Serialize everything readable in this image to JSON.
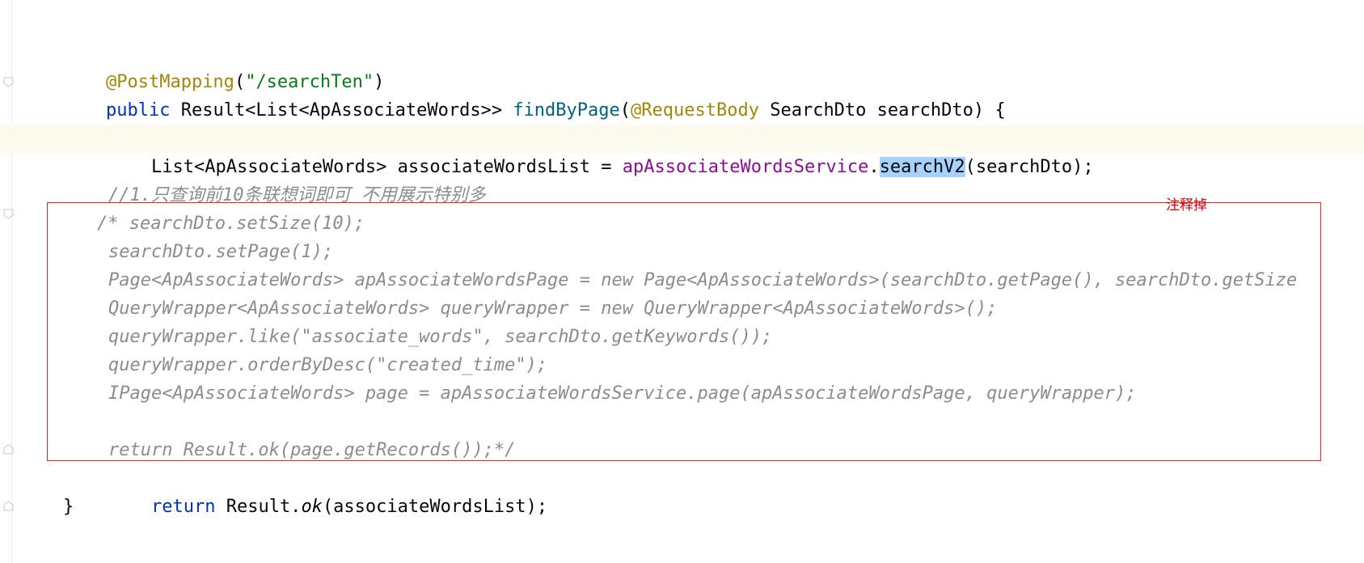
{
  "editor": {
    "lines": {
      "l1": {
        "annotation": "@PostMapping",
        "open_paren": "(",
        "path": "\"/searchTen\"",
        "close_paren": ")"
      },
      "l2": {
        "kw_public": "public",
        "type": " Result<List<ApAssociateWords>> ",
        "method": "findByPage",
        "open": "(",
        "annotation": "@RequestBody",
        "params": " SearchDto searchDto) {"
      },
      "l4": {
        "prefix": "List<ApAssociateWords> associateWordsList = ",
        "service_field": "apAssociateWordsService",
        "dot": ".",
        "selected_method": "searchV2",
        "suffix": "(searchDto);"
      },
      "l6": "//1.只查询前10条联想词即可 不用展示特别多",
      "l7": "/* searchDto.setSize(10);",
      "l8": "searchDto.setPage(1);",
      "l9": "Page<ApAssociateWords> apAssociateWordsPage = new Page<ApAssociateWords>(searchDto.getPage(), searchDto.getSize",
      "l10": "QueryWrapper<ApAssociateWords> queryWrapper = new QueryWrapper<ApAssociateWords>();",
      "l11": "queryWrapper.like(\"associate_words\", searchDto.getKeywords());",
      "l12": "queryWrapper.orderByDesc(\"created_time\");",
      "l13": "IPage<ApAssociateWords> page = apAssociateWordsService.page(apAssociateWordsPage, queryWrapper);",
      "l15": "return Result.ok(page.getRecords());*/",
      "l16": {
        "kw_return": "return",
        "result": " Result.",
        "ok": "ok",
        "rest": "(associateWordsList);"
      },
      "l17": "}"
    },
    "annotation_note": "注释掉",
    "icons": {
      "intention": "lightbulb-icon",
      "fold": "fold-marker-icon"
    },
    "colors": {
      "keyword": "#0033b3",
      "annotation": "#9e880d",
      "string": "#067d17",
      "method": "#00627a",
      "field": "#871094",
      "comment": "#8c8c8c",
      "selection": "#a6d2ff",
      "highlight_box": "#e2262b",
      "note_text": "#d3000c"
    }
  }
}
